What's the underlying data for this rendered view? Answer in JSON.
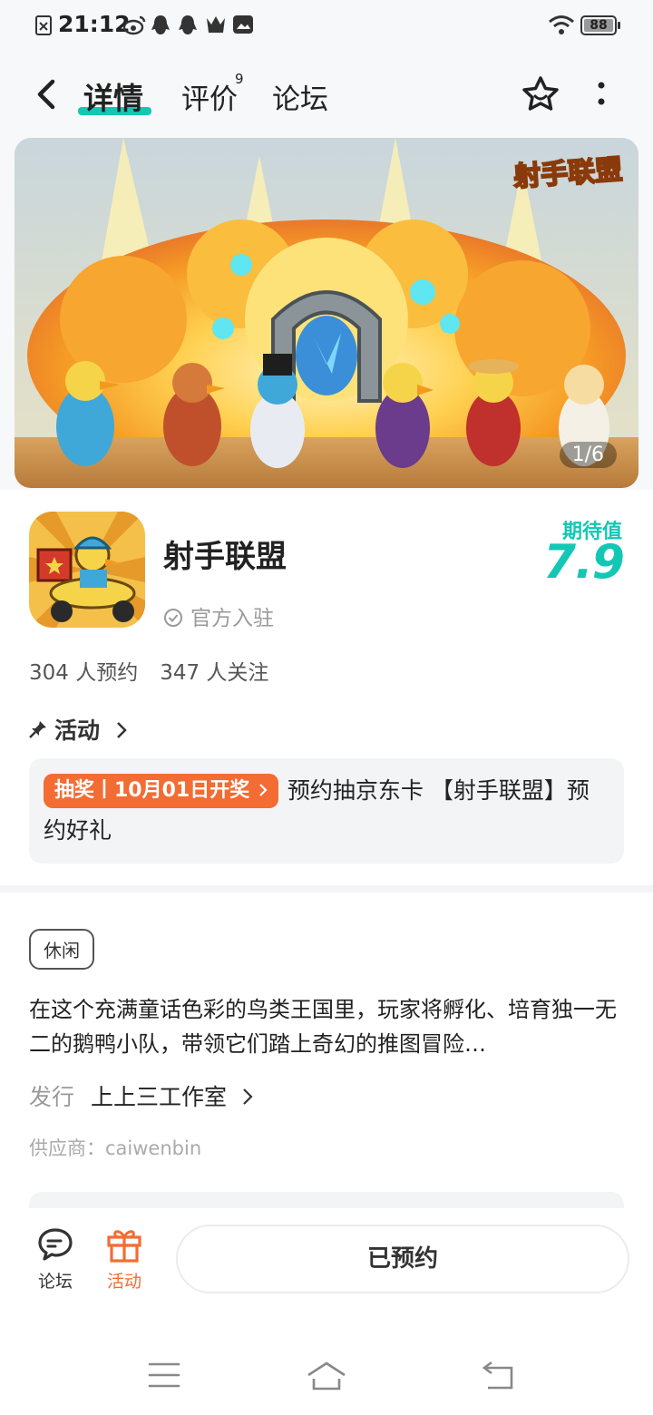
{
  "status_bar": {
    "time": "21:12",
    "battery": "88"
  },
  "nav": {
    "tabs": [
      {
        "label": "详情",
        "active": true
      },
      {
        "label": "评价",
        "badge": "9"
      },
      {
        "label": "论坛"
      }
    ]
  },
  "banner": {
    "counter": "1/6",
    "logo_text": "射手联盟"
  },
  "app": {
    "name": "射手联盟",
    "official": "官方入驻",
    "expect_label": "期待值",
    "expect_score": "7.9",
    "reservations": "304 人预约",
    "followers": "347 人关注"
  },
  "activity": {
    "heading": "活动",
    "tag": "抽奖丨10月01日开奖",
    "text": "预约抽京东卡 【射手联盟】预约好礼"
  },
  "details": {
    "genre": "休闲",
    "description": "在这个充满童话色彩的鸟类王国里，玩家将孵化、培育独一无二的鹅鸭小队，带领它们踏上奇幻的推图冒险…",
    "publisher_label": "发行",
    "publisher": "上上三工作室",
    "supplier": "供应商：caiwenbin"
  },
  "bottom_bar": {
    "forum_label": "论坛",
    "activity_label": "活动",
    "reserve_button": "已预约"
  },
  "colors": {
    "accent": "#14c7b4",
    "orange": "#f36c33"
  }
}
